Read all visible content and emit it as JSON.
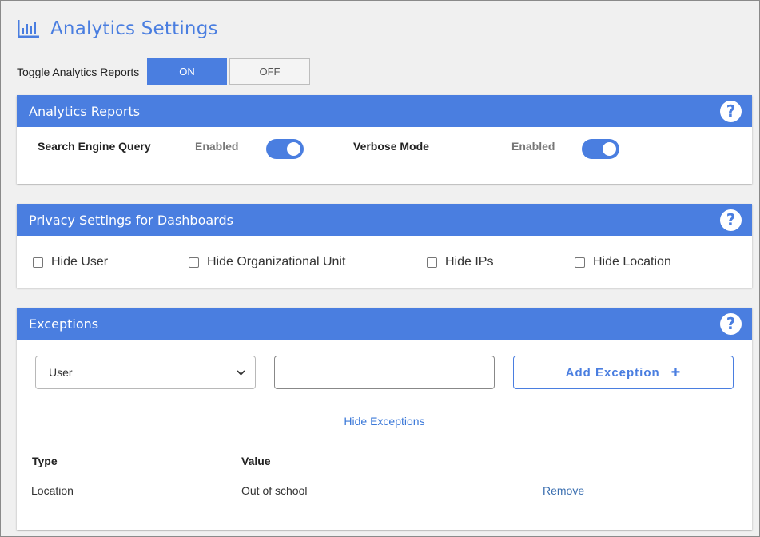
{
  "header": {
    "title": "Analytics Settings",
    "icon": "bar-chart-icon",
    "accent": "#4a7ee0"
  },
  "toggle": {
    "label": "Toggle Analytics Reports",
    "on_label": "ON",
    "off_label": "OFF",
    "selected": "ON"
  },
  "analytics_reports": {
    "title": "Analytics Reports",
    "help": "?",
    "items": [
      {
        "label": "Search Engine Query",
        "status": "Enabled",
        "enabled": true
      },
      {
        "label": "Verbose Mode",
        "status": "Enabled",
        "enabled": true
      }
    ]
  },
  "privacy": {
    "title": "Privacy Settings for Dashboards",
    "help": "?",
    "options": [
      {
        "label": "Hide User",
        "checked": false
      },
      {
        "label": "Hide Organizational Unit",
        "checked": false
      },
      {
        "label": "Hide IPs",
        "checked": false
      },
      {
        "label": "Hide Location",
        "checked": false
      }
    ]
  },
  "exceptions": {
    "title": "Exceptions",
    "help": "?",
    "type_select": "User",
    "value_input": "",
    "add_label": "Add Exception",
    "add_icon": "+",
    "hide_label": "Hide Exceptions",
    "columns": {
      "type": "Type",
      "value": "Value"
    },
    "rows": [
      {
        "type": "Location",
        "value": "Out of school",
        "action": "Remove"
      }
    ]
  }
}
